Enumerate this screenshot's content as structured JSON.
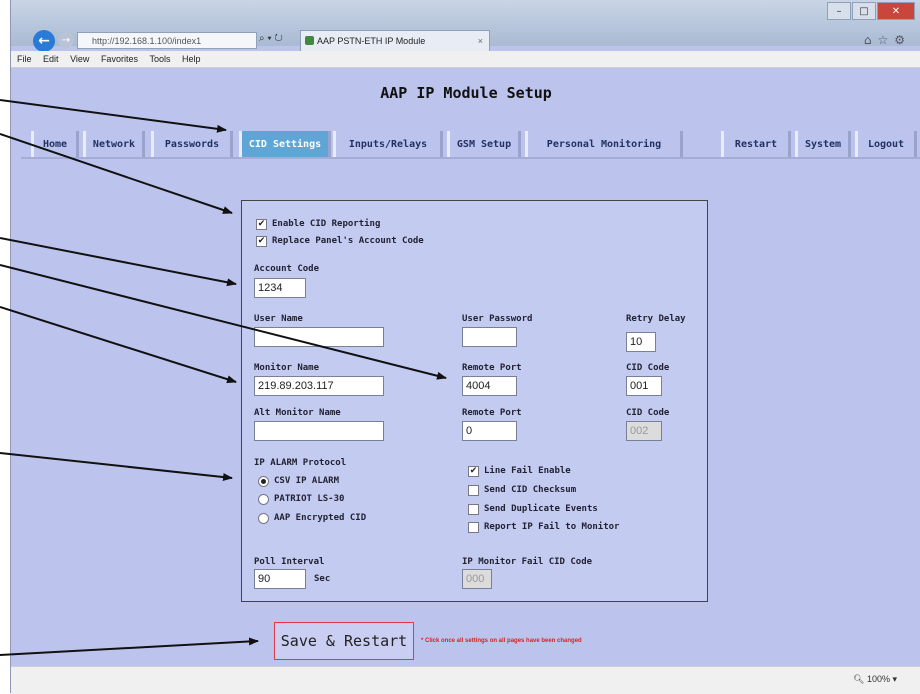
{
  "browser": {
    "address": "http://192.168.1.100/index1",
    "tab_title": "AAP PSTN-ETH IP Module",
    "menu": [
      "File",
      "Edit",
      "View",
      "Favorites",
      "Tools",
      "Help"
    ],
    "zoom": "100%"
  },
  "page": {
    "title": "AAP IP Module Setup",
    "nav": [
      "Home",
      "Network",
      "Passwords",
      "CID Settings",
      "Inputs/Relays",
      "GSM Setup",
      "Personal Monitoring",
      "Restart",
      "System",
      "Logout"
    ],
    "active_nav": "CID Settings"
  },
  "form": {
    "enable_cid": {
      "label": "Enable CID Reporting",
      "checked": true
    },
    "replace_account": {
      "label": "Replace Panel's Account Code",
      "checked": true
    },
    "account_code": {
      "label": "Account Code",
      "value": "1234"
    },
    "user_name": {
      "label": "User Name",
      "value": ""
    },
    "user_password": {
      "label": "User Password",
      "value": ""
    },
    "retry_delay": {
      "label": "Retry Delay",
      "value": "10"
    },
    "monitor_name": {
      "label": "Monitor Name",
      "value": "219.89.203.117"
    },
    "remote_port": {
      "label": "Remote Port",
      "value": "4004"
    },
    "cid_code": {
      "label": "CID Code",
      "value": "001"
    },
    "alt_monitor_name": {
      "label": "Alt Monitor Name",
      "value": ""
    },
    "alt_remote_port": {
      "label": "Remote Port",
      "value": "0"
    },
    "alt_cid_code": {
      "label": "CID Code",
      "value": "002"
    },
    "protocol": {
      "label": "IP ALARM Protocol",
      "options": [
        "CSV IP ALARM",
        "PATRIOT LS-30",
        "AAP Encrypted CID"
      ],
      "selected": "CSV IP ALARM"
    },
    "line_fail_enable": {
      "label": "Line Fail Enable",
      "checked": true
    },
    "send_cid_checksum": {
      "label": "Send CID Checksum",
      "checked": false
    },
    "send_duplicate_events": {
      "label": "Send Duplicate Events",
      "checked": false
    },
    "report_ip_fail": {
      "label": "Report IP Fail to Monitor",
      "checked": false
    },
    "poll_interval": {
      "label": "Poll Interval",
      "value": "90",
      "unit": "Sec"
    },
    "ip_monitor_fail_cid": {
      "label": "IP Monitor Fail CID Code",
      "value": "000"
    }
  },
  "actions": {
    "save_label": "Save & Restart",
    "save_note": "* Click once all settings on all pages have been changed"
  },
  "checkmark": "✔"
}
